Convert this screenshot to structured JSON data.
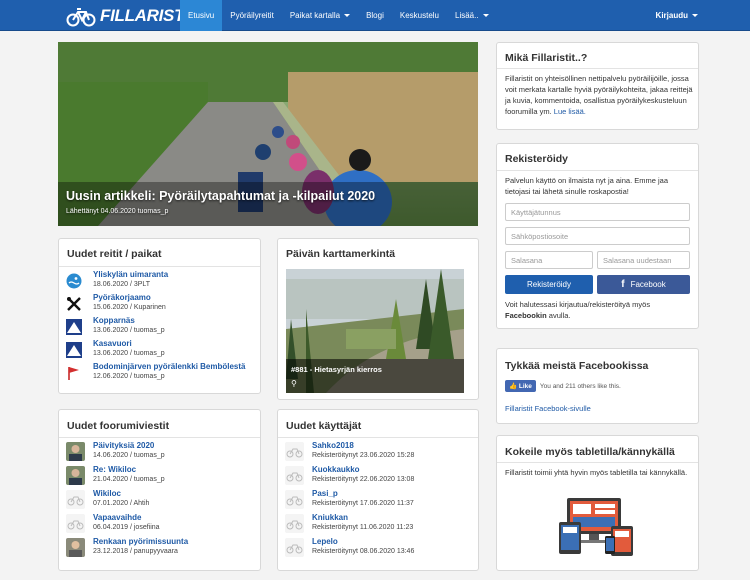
{
  "nav": {
    "brand": "FILLARISTIT",
    "items": [
      {
        "label": "Etusivu",
        "active": true,
        "dropdown": false
      },
      {
        "label": "Pyöräilyreitit",
        "active": false,
        "dropdown": false
      },
      {
        "label": "Paikat kartalla",
        "active": false,
        "dropdown": true
      },
      {
        "label": "Blogi",
        "active": false,
        "dropdown": false
      },
      {
        "label": "Keskustelu",
        "active": false,
        "dropdown": false
      },
      {
        "label": "Lisää..",
        "active": false,
        "dropdown": true
      }
    ],
    "login": "Kirjaudu"
  },
  "hero": {
    "title": "Uusin artikkeli: Pyöräilytapahtumat ja -kilpailut 2020",
    "meta": "Lähettänyt 04.06.2020 tuomas_p"
  },
  "routes": {
    "title": "Uudet reitit / paikat",
    "items": [
      {
        "icon": "swimming-icon",
        "title": "Yliskylän uimaranta",
        "meta": "18.06.2020 / 3PLT"
      },
      {
        "icon": "tools-icon",
        "title": "Pyöräkorjaamo",
        "meta": "15.06.2020 / Kuparinen"
      },
      {
        "icon": "mountain-icon",
        "title": "Kopparnäs",
        "meta": "13.06.2020 / tuomas_p"
      },
      {
        "icon": "mountain-icon",
        "title": "Kasavuori",
        "meta": "13.06.2020 / tuomas_p"
      },
      {
        "icon": "flag-icon",
        "title": "Bodominjärven pyörälenkki Bembölestä",
        "meta": "12.06.2020 / tuomas_p"
      }
    ]
  },
  "mapmark": {
    "title": "Päivän karttamerkintä",
    "caption": "#881 - Hietasyrjän kierros",
    "pin": "⚲"
  },
  "forum": {
    "title": "Uudet foorumiviestit",
    "items": [
      {
        "title": "Päivityksiä 2020",
        "meta": "14.06.2020 / tuomas_p",
        "avatar": "photo"
      },
      {
        "title": "Re: Wikiloc",
        "meta": "21.04.2020 / tuomas_p",
        "avatar": "photo"
      },
      {
        "title": "Wikiloc",
        "meta": "07.01.2020 / Ahtih",
        "avatar": "bike"
      },
      {
        "title": "Vapaavaihde",
        "meta": "06.04.2019 / josefiina",
        "avatar": "bike"
      },
      {
        "title": "Renkaan pyörimissuunta",
        "meta": "23.12.2018 / panupyyvaara",
        "avatar": "photo"
      }
    ]
  },
  "users": {
    "title": "Uudet käyttäjät",
    "items": [
      {
        "name": "Sahko2018",
        "meta": "Rekisteröitynyt 23.06.2020 15:28"
      },
      {
        "name": "Kuokkaukko",
        "meta": "Rekisteröitynyt 22.06.2020 13:08"
      },
      {
        "name": "Pasi_p",
        "meta": "Rekisteröitynyt 17.06.2020 11:37"
      },
      {
        "name": "Kniukkan",
        "meta": "Rekisteröitynyt 11.06.2020 11:23"
      },
      {
        "name": "Lepelo",
        "meta": "Rekisteröitynyt 08.06.2020 13:46"
      }
    ]
  },
  "about": {
    "title": "Mikä Fillaristit..?",
    "text": "Fillaristit on yhteisöllinen nettipalvelu pyöräilijöille, jossa voit merkata kartalle hyviä pyöräilykohteita, jakaa reittejä ja kuvia, kommentoida, osallistua pyöräilykeskusteluun foorumilla ym.",
    "link": "Lue lisää."
  },
  "register": {
    "title": "Rekisteröidy",
    "text": "Palvelun käyttö on ilmaista nyt ja aina. Emme jaa tietojasi tai lähetä sinulle roskapostia!",
    "username_placeholder": "Käyttäjätunnus",
    "email_placeholder": "Sähköpostiosoite",
    "password_placeholder": "Salasana",
    "password2_placeholder": "Salasana uudestaan",
    "register_button": "Rekisteröidy",
    "facebook_button": "Facebook",
    "facebook_note_1": "Voit halutessasi kirjautua/rekisteröityä myös",
    "facebook_note_bold": "Facebookin",
    "facebook_note_2": "avulla."
  },
  "facebook": {
    "title": "Tykkää meistä Facebookissa",
    "like_button": "Like",
    "like_text": "You and 211 others like this.",
    "link": "Fillaristit Facebook-sivulle"
  },
  "tablet": {
    "title": "Kokeile myös tabletilla/kännykällä",
    "text": "Fillaristit toimii yhtä hyvin myös tabletilla tai kännykällä."
  },
  "colors": {
    "nav_bg": "#1f5fae",
    "nav_active": "#2c87d5",
    "link": "#1f5aa6",
    "facebook": "#3b5998"
  }
}
